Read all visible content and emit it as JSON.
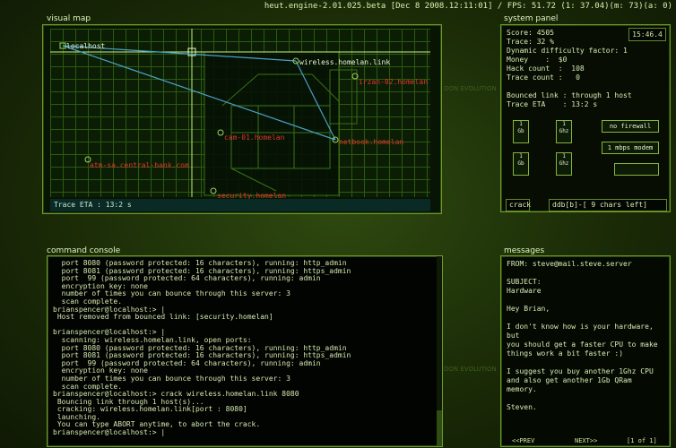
{
  "topbar": {
    "engine": "heut.engine-2.01.025.beta [Dec  8 2008.12:11:01] / FPS: 51.72 (1: 37.04)(m:  73)(a: 0)"
  },
  "visual_map": {
    "title": "visual map",
    "nodes": [
      {
        "label": "localhost",
        "color": "white"
      },
      {
        "label": "wireless.homelan.link",
        "color": "white"
      },
      {
        "label": "irzan-02.homelan",
        "color": "red"
      },
      {
        "label": "cam-01.homelan",
        "color": "red"
      },
      {
        "label": "netbook.homelan",
        "color": "red"
      },
      {
        "label": "atm-sa.central-bank.com",
        "color": "red"
      },
      {
        "label": "security.homelan",
        "color": "red"
      }
    ],
    "trace_eta": "Trace ETA   : 13:2 s"
  },
  "system_panel": {
    "title": "system panel",
    "stats": "Score: 4505\nTrace: 32 %\nDynamic difficulty factor: 1\nMoney    :  $0\nHack count  :  108\nTrace count :   0\n\nBounced link : through 1 host\nTrace ETA    : 13:2 s",
    "clock": "15:46.4",
    "hw": [
      {
        "top": "1",
        "bottom": "Gb"
      },
      {
        "top": "1",
        "bottom": "Ghz"
      },
      {
        "top": "1",
        "bottom": "Gb"
      },
      {
        "top": "1",
        "bottom": "Ghz"
      }
    ],
    "no_firewall": "no firewall",
    "modem": "1 mbps modem",
    "cmd": "crack",
    "cmd_arg": "ddb[b]-[  9 chars left]"
  },
  "console": {
    "title": "command console",
    "lines": [
      "  port 8080 (password protected: 16 characters), running: http_admin",
      "  port 8081 (password protected: 16 characters), running: https_admin",
      "  port  99 (password protected: 64 characters), running: admin",
      "  encryption key: none",
      "  number of times you can bounce through this server: 3",
      "  scan complete.",
      "brianspencer@localhost:> |",
      " Host removed from bounced link: [security.homelan]",
      "",
      "brianspencer@localhost:> |",
      "  scanning: wireless.homelan.link, open ports:",
      "  port 8080 (password protected: 16 characters), running: http_admin",
      "  port 8081 (password protected: 16 characters), running: https_admin",
      "  port  99 (password protected: 64 characters), running: admin",
      "  encryption key: none",
      "  number of times you can bounce through this server: 3",
      "  scan complete.",
      "brianspencer@localhost:> crack wireless.homelan.link 8080",
      " Bouncing link through 1 host(s)...",
      " cracking: wireless.homelan.link[port : 8080]",
      " launching.",
      " You can type ABORT anytime, to abort the crack.",
      "brianspencer@localhost:> |"
    ]
  },
  "messages": {
    "title": "messages",
    "body": "FROM: steve@mail.steve.server\n\nSUBJECT:\nHardware\n\nHey Brian,\n\nI don't know how is your hardware, but\nyou should get a faster CPU to make\nthings work a bit faster :)\n\nI suggest you buy another 1Ghz CPU\nand also get another 1Gb QRam memory.\n\nSteven.",
    "prev": "<<PREV",
    "next": "NEXT>>",
    "page": "[1 of 1]"
  }
}
